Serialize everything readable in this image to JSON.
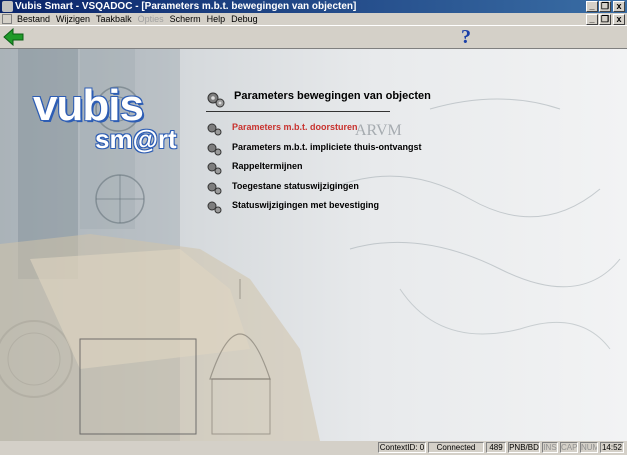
{
  "window": {
    "title": "Vubis Smart - VSQADOC - [Parameters m.b.t. bewegingen van objecten]",
    "controls": [
      "_",
      "❐",
      "x"
    ]
  },
  "menubar": {
    "items": [
      {
        "label": "Bestand",
        "enabled": true
      },
      {
        "label": "Wijzigen",
        "enabled": true
      },
      {
        "label": "Taakbalk",
        "enabled": true
      },
      {
        "label": "Opties",
        "enabled": false
      },
      {
        "label": "Scherm",
        "enabled": true
      },
      {
        "label": "Help",
        "enabled": true
      },
      {
        "label": "Debug",
        "enabled": true
      }
    ]
  },
  "toolbar": {
    "back_icon": "green-left-arrow-icon",
    "help_label": "?"
  },
  "logo": {
    "line1": "vubis",
    "line2": "sm@rt"
  },
  "background_texts": [
    "ARVM"
  ],
  "section": {
    "title": "Parameters bewegingen van objecten",
    "items": [
      {
        "label": "Parameters m.b.t. doorsturen",
        "active": true
      },
      {
        "label": "Parameters m.b.t. impliciete thuis-ontvangst",
        "active": false
      },
      {
        "label": "Rappeltermijnen",
        "active": false
      },
      {
        "label": "Toegestane statuswijzigingen",
        "active": false
      },
      {
        "label": "Statuswijzigingen met bevestiging",
        "active": false
      }
    ]
  },
  "statusbar": {
    "context": "ContextID: 0",
    "connection": "Connected",
    "code1": "489",
    "code2": "PNB/BD",
    "ins": "INS",
    "caps": "CAPS",
    "num": "NUM",
    "time": "14:52"
  },
  "colors": {
    "titlebar": "#0a246a",
    "active_item": "#c8322e",
    "logo_blue": "#2d5db4"
  }
}
